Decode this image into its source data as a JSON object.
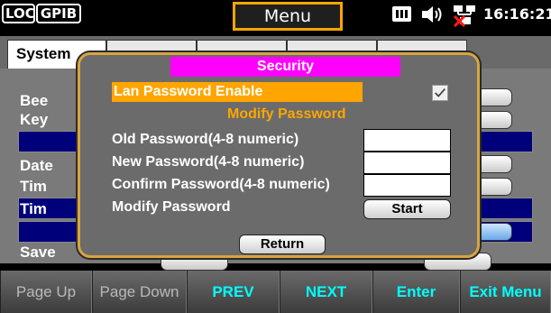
{
  "status": {
    "loc_label": "LOC",
    "gpib_label": "GPIB",
    "title": "Menu",
    "time": "16:16:21",
    "icons": [
      "keyboard-icon",
      "speaker-icon",
      "lan-disconnected-icon"
    ],
    "accent_color": "#ffa500"
  },
  "background": {
    "active_tab": "System",
    "rows": [
      "Bee",
      "Key",
      "Date",
      "Tim",
      "Tim",
      "Save"
    ]
  },
  "dialog": {
    "title": "Security",
    "lan_password_enable_label": "Lan Password Enable",
    "lan_password_enable_checked": true,
    "section_heading": "Modify Password",
    "old_password_label": "Old Password(4-8 numeric)",
    "old_password_value": "",
    "new_password_label": "New Password(4-8 numeric)",
    "new_password_value": "",
    "confirm_password_label": "Confirm Password(4-8 numeric)",
    "confirm_password_value": "",
    "modify_password_label": "Modify Password",
    "start_label": "Start",
    "return_label": "Return",
    "title_color": "#ff00ff"
  },
  "softkeys": [
    {
      "label": "Page Up",
      "enabled": false
    },
    {
      "label": "Page Down",
      "enabled": false
    },
    {
      "label": "PREV",
      "enabled": true
    },
    {
      "label": "NEXT",
      "enabled": true
    },
    {
      "label": "Enter",
      "enabled": true
    },
    {
      "label": "Exit Menu",
      "enabled": true
    }
  ]
}
